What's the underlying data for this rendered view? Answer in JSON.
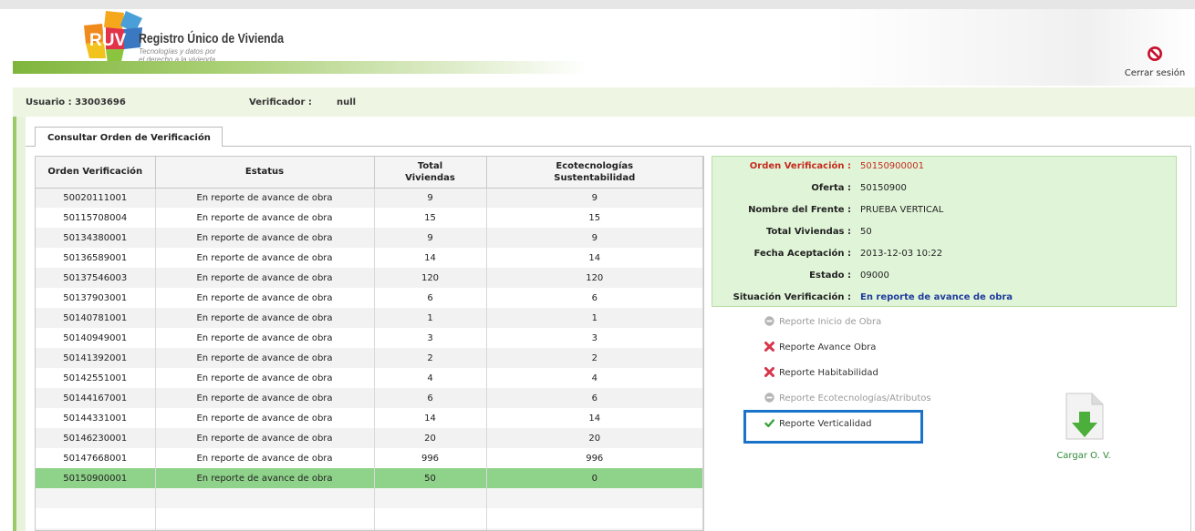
{
  "brand": {
    "logo_text": "RUV",
    "name": "Registro Único de Vivienda",
    "tagline_1": "Tecnologías y datos por",
    "tagline_2": "el derecho a la vivienda"
  },
  "header": {
    "logout_label": "Cerrar sesión"
  },
  "user_bar": {
    "usuario": "Usuario : 33003696",
    "verificador_label": "Verificador :",
    "verificador_value": "null"
  },
  "tab": {
    "label": "Consultar Orden de Verificación"
  },
  "grid": {
    "columns": [
      "Orden Verificación",
      "Estatus",
      "Total\nViviendas",
      "Ecotecnologías\nSustentabilidad"
    ],
    "rows": [
      [
        "50020111001",
        "En reporte de avance de obra",
        "9",
        "9"
      ],
      [
        "50115708004",
        "En reporte de avance de obra",
        "15",
        "15"
      ],
      [
        "50134380001",
        "En reporte de avance de obra",
        "9",
        "9"
      ],
      [
        "50136589001",
        "En reporte de avance de obra",
        "14",
        "14"
      ],
      [
        "50137546003",
        "En reporte de avance de obra",
        "120",
        "120"
      ],
      [
        "50137903001",
        "En reporte de avance de obra",
        "6",
        "6"
      ],
      [
        "50140781001",
        "En reporte de avance de obra",
        "1",
        "1"
      ],
      [
        "50140949001",
        "En reporte de avance de obra",
        "3",
        "3"
      ],
      [
        "50141392001",
        "En reporte de avance de obra",
        "2",
        "2"
      ],
      [
        "50142551001",
        "En reporte de avance de obra",
        "4",
        "4"
      ],
      [
        "50144167001",
        "En reporte de avance de obra",
        "6",
        "6"
      ],
      [
        "50144331001",
        "En reporte de avance de obra",
        "14",
        "14"
      ],
      [
        "50146230001",
        "En reporte de avance de obra",
        "20",
        "20"
      ],
      [
        "50147668001",
        "En reporte de avance de obra",
        "996",
        "996"
      ],
      [
        "50150900001",
        "En reporte de avance de obra",
        "50",
        "0"
      ]
    ],
    "selected_row": 14
  },
  "details": [
    {
      "label": "Orden Verificación :",
      "value": "50150900001",
      "style": "red"
    },
    {
      "label": "Oferta :",
      "value": "50150900",
      "style": ""
    },
    {
      "label": "Nombre del Frente :",
      "value": "PRUEBA VERTICAL",
      "style": ""
    },
    {
      "label": "Total Viviendas :",
      "value": "50",
      "style": ""
    },
    {
      "label": "Fecha Aceptación :",
      "value": "2013-12-03 10:22",
      "style": ""
    },
    {
      "label": "Estado :",
      "value": "09000",
      "style": ""
    },
    {
      "label": "Situación Verificación :",
      "value": "En reporte de avance de obra",
      "style": "blue"
    }
  ],
  "reports": [
    {
      "label": "Reporte Inicio de Obra",
      "icon": "minus-circle-icon",
      "state": "disabled"
    },
    {
      "label": "Reporte Avance Obra",
      "icon": "red-x-icon",
      "state": "pending"
    },
    {
      "label": "Reporte Habitabilidad",
      "icon": "red-x-icon",
      "state": "pending"
    },
    {
      "label": "Reporte Ecotecnologías/Atributos",
      "icon": "minus-circle-icon",
      "state": "disabled"
    },
    {
      "label": "Reporte Verticalidad",
      "icon": "green-check-icon",
      "state": "done"
    }
  ],
  "upload": {
    "label": "Cargar O. V."
  },
  "colors": {
    "accent_green": "#7fb53c",
    "selected_row": "#8fd38a",
    "info_bg": "#e0f5d8",
    "highlight": "#1a73c9",
    "label_red": "#c62b1e",
    "status_blue": "#1f3b9c"
  }
}
